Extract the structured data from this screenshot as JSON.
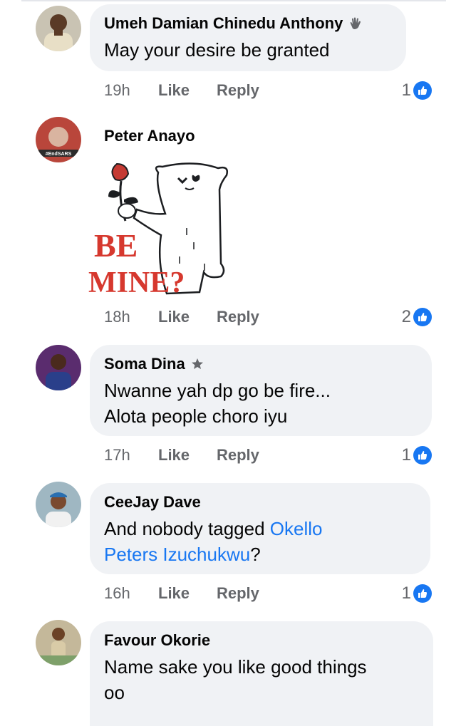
{
  "comments": [
    {
      "author": "Umeh Damian Chinedu Anthony",
      "text": "May your desire be granted",
      "time": "19h",
      "like_label": "Like",
      "reply_label": "Reply",
      "reactions": "1",
      "author_badge": "wave-hand-icon"
    },
    {
      "author": "Peter Anayo",
      "sticker_text_line1": "BE",
      "sticker_text_line2": "MINE?",
      "time": "18h",
      "like_label": "Like",
      "reply_label": "Reply",
      "reactions": "2",
      "avatar_caption": "#EndSARS"
    },
    {
      "author": "Soma Dina",
      "text_line1": "Nwanne yah dp go be fire...",
      "text_line2": "Alota people choro iyu",
      "time": "17h",
      "like_label": "Like",
      "reply_label": "Reply",
      "reactions": "1",
      "author_badge": "star-icon"
    },
    {
      "author": "CeeJay Dave",
      "text_prefix": "And nobody tagged ",
      "tag_part1": "Okello",
      "tag_part2": "Peters Izuchukwu",
      "text_suffix": "?",
      "time": "16h",
      "like_label": "Like",
      "reply_label": "Reply",
      "reactions": "1"
    },
    {
      "author": "Favour Okorie",
      "text_line1": "Name sake you like good things",
      "text_line2": "oo"
    }
  ],
  "colors": {
    "bubble": "#f0f2f5",
    "link": "#1877f2",
    "meta": "#65676b",
    "like_badge": "#1877f2"
  }
}
